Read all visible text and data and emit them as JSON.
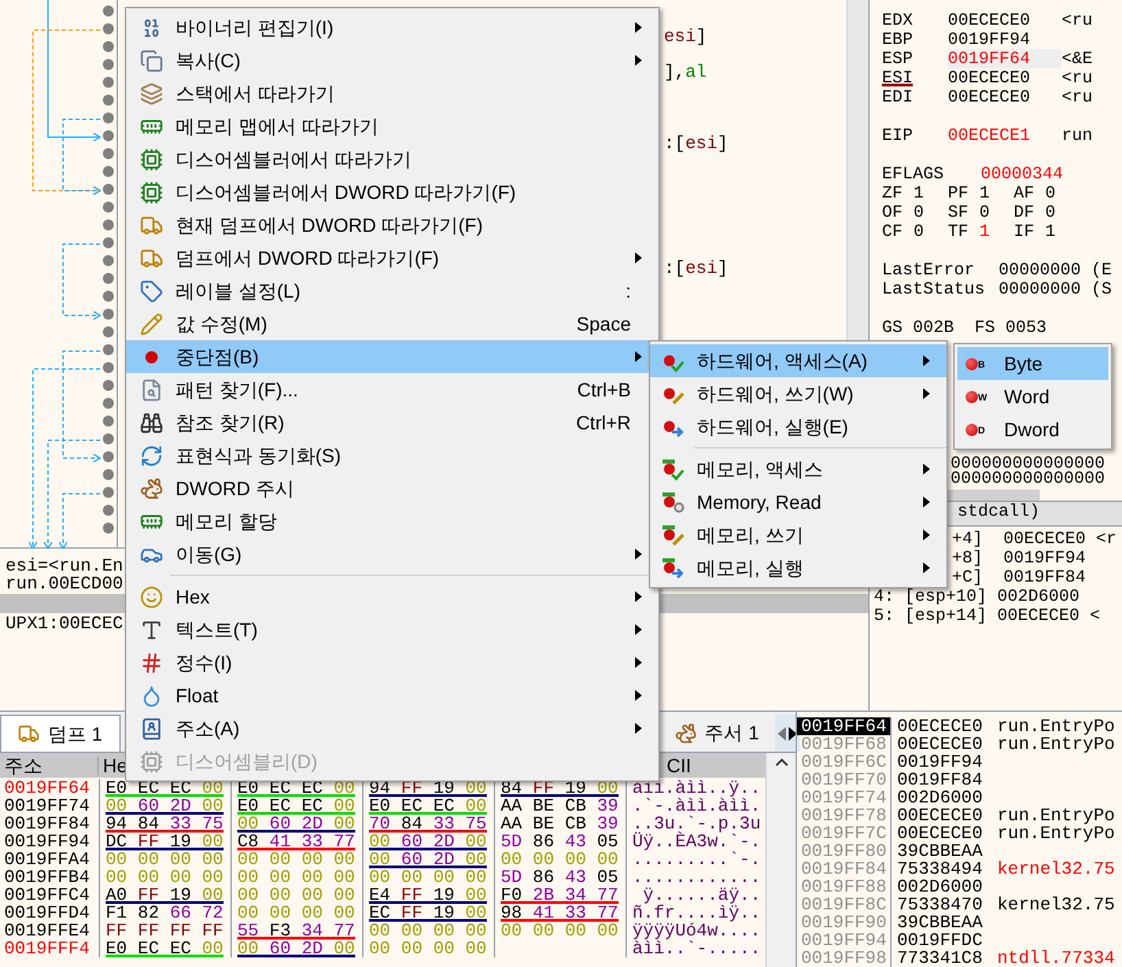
{
  "disassembly": {
    "code_lines": [
      [
        {
          "text": "esi",
          "color": "#800000"
        },
        {
          "text": "]",
          "color": "#000000"
        }
      ],
      [
        {
          "text": "],",
          "color": "#000000"
        },
        {
          "text": "al",
          "color": "#008000"
        }
      ],
      [
        {
          "text": ":[",
          "color": "#000000"
        },
        {
          "text": "esi",
          "color": "#800000"
        },
        {
          "text": "]",
          "color": "#000000"
        }
      ],
      [
        {
          "text": ":[",
          "color": "#000000"
        },
        {
          "text": "esi",
          "color": "#800000"
        },
        {
          "text": "]",
          "color": "#000000"
        }
      ]
    ]
  },
  "info_pane": {
    "lines": [
      "esi=<run.En",
      "run.00ECD00"
    ],
    "section": "UPX1:00ECEC"
  },
  "registers": [
    {
      "name": "EDX",
      "value": "00ECECE0",
      "comment": "<ru",
      "changed": false,
      "underlined": false
    },
    {
      "name": "EBP",
      "value": "0019FF94",
      "changed": false,
      "underlined": false
    },
    {
      "name": "ESP",
      "value": "0019FF64",
      "comment": "<&E",
      "changed": true,
      "underlined": false
    },
    {
      "name": "ESI",
      "value": "00ECECE0",
      "comment": "<ru",
      "changed": false,
      "underlined": true
    },
    {
      "name": "EDI",
      "value": "00ECECE0",
      "comment": "<ru",
      "changed": false,
      "underlined": false
    }
  ],
  "eip": {
    "name": "EIP",
    "value": "00ECECE1",
    "comment": "run",
    "changed": true
  },
  "eflags": {
    "name": "EFLAGS",
    "value": "00000344",
    "changed": true
  },
  "flags": [
    [
      {
        "name": "ZF",
        "value": "1",
        "changed": false
      },
      {
        "name": "PF",
        "value": "1",
        "changed": false
      },
      {
        "name": "AF",
        "value": "0",
        "changed": false
      }
    ],
    [
      {
        "name": "OF",
        "value": "0",
        "changed": false
      },
      {
        "name": "SF",
        "value": "0",
        "changed": false
      },
      {
        "name": "DF",
        "value": "0",
        "changed": false
      }
    ],
    [
      {
        "name": "CF",
        "value": "0",
        "changed": false
      },
      {
        "name": "TF",
        "value": "1",
        "changed": true
      },
      {
        "name": "IF",
        "value": "1",
        "changed": false
      }
    ]
  ],
  "last_error": [
    {
      "name": "LastError",
      "value": "00000000 (E"
    },
    {
      "name": "LastStatus",
      "value": "00000000 (S"
    }
  ],
  "segments": "GS 002B  FS 0053",
  "fpu_lines": [
    "000000000000000",
    "000000000000000"
  ],
  "call_stack": {
    "header": "stdcall)",
    "rows": [
      "+4]  00ECECE0 <r",
      "+8]  0019FF94",
      "+C]  0019FF84",
      "4: [esp+10] 002D6000",
      "5: [esp+14] 00ECECE0 <"
    ]
  },
  "bottom_tabs": [
    {
      "label": "덤프 1",
      "selected": true
    },
    {
      "label": "주서 1",
      "selected": false
    }
  ],
  "dump": {
    "columns": [
      "주소",
      "He",
      "CII"
    ],
    "rows": [
      {
        "address": "0019FF64",
        "highlight": true,
        "groups": [
          {
            "bytes": "E0 EC EC 00",
            "color": "#00e000"
          },
          {
            "bytes": "E0 EC EC 00",
            "color": "#00e000"
          },
          {
            "bytes": "94 FF 19 00",
            "color": "#000080"
          },
          {
            "bytes": "84 FF 19 00",
            "color": "#000080"
          }
        ],
        "ascii": "àìì.àìì..ÿ.."
      },
      {
        "address": "0019FF74",
        "highlight": false,
        "groups": [
          {
            "bytes": "00 60 2D 00",
            "color": "#000080"
          },
          {
            "bytes": "E0 EC EC 00",
            "color": "#00e000"
          },
          {
            "bytes": "E0 EC EC 00",
            "color": "#00e000"
          },
          {
            "bytes": "AA BE CB 39"
          }
        ],
        "ascii": ".`-.àìì.àìì."
      },
      {
        "address": "0019FF84",
        "highlight": false,
        "groups": [
          {
            "bytes": "94 84 33 75",
            "color": "#ff0000"
          },
          {
            "bytes": "00 60 2D 00",
            "color": "#000080"
          },
          {
            "bytes": "70 84 33 75",
            "color": "#ff0000"
          },
          {
            "bytes": "AA BE CB 39"
          }
        ],
        "ascii": "..3u.`-.p.3u"
      },
      {
        "address": "0019FF94",
        "highlight": false,
        "groups": [
          {
            "bytes": "DC FF 19 00",
            "color": "#000080"
          },
          {
            "bytes": "C8 41 33 77",
            "color": "#ff0000"
          },
          {
            "bytes": "00 60 2D 00",
            "color": "#000080"
          },
          {
            "bytes": "5D 86 43 05"
          }
        ],
        "ascii": "Üÿ..ÈA3w.`-."
      },
      {
        "address": "0019FFA4",
        "highlight": false,
        "groups": [
          {
            "bytes": "00 00 00 00"
          },
          {
            "bytes": "00 00 00 00"
          },
          {
            "bytes": "00 60 2D 00",
            "color": "#000080"
          },
          {
            "bytes": "00 00 00 00"
          }
        ],
        "ascii": ".........`-."
      },
      {
        "address": "0019FFB4",
        "highlight": false,
        "groups": [
          {
            "bytes": "00 00 00 00"
          },
          {
            "bytes": "00 00 00 00"
          },
          {
            "bytes": "00 00 00 00"
          },
          {
            "bytes": "5D 86 43 05"
          }
        ],
        "ascii": "............"
      },
      {
        "address": "0019FFC4",
        "highlight": false,
        "groups": [
          {
            "bytes": "A0 FF 19 00",
            "color": "#000080"
          },
          {
            "bytes": "00 00 00 00"
          },
          {
            "bytes": "E4 FF 19 00",
            "color": "#000080"
          },
          {
            "bytes": "F0 2B 34 77",
            "color": "#ff0000"
          }
        ],
        "ascii": " ÿ......äÿ.."
      },
      {
        "address": "0019FFD4",
        "highlight": false,
        "groups": [
          {
            "bytes": "F1 82 66 72"
          },
          {
            "bytes": "00 00 00 00"
          },
          {
            "bytes": "EC FF 19 00",
            "color": "#000080"
          },
          {
            "bytes": "98 41 33 77",
            "color": "#ff0000"
          }
        ],
        "ascii": "ñ.fr....ìÿ.."
      },
      {
        "address": "0019FFE4",
        "highlight": false,
        "groups": [
          {
            "bytes": "FF FF FF FF"
          },
          {
            "bytes": "55 F3 34 77",
            "color": "#ff0000"
          },
          {
            "bytes": "00 00 00 00"
          },
          {
            "bytes": "00 00 00 00"
          }
        ],
        "ascii": "ÿÿÿÿUó4w...."
      },
      {
        "address": "0019FFF4",
        "highlight": true,
        "groups": [
          {
            "bytes": "E0 EC EC 00",
            "color": "#00e000"
          },
          {
            "bytes": "00 60 2D 00",
            "color": "#000080"
          },
          {
            "bytes": "00 00 00 00"
          }
        ],
        "ascii": "àìì..`-....."
      }
    ]
  },
  "stack": [
    {
      "address": "0019FF64",
      "value": "00ECECE0",
      "comment": "run.EntryPo",
      "selected": true,
      "alert": false
    },
    {
      "address": "0019FF68",
      "value": "00ECECE0",
      "comment": "run.EntryPo",
      "selected": false,
      "alert": false
    },
    {
      "address": "0019FF6C",
      "value": "0019FF94",
      "selected": false
    },
    {
      "address": "0019FF70",
      "value": "0019FF84",
      "selected": false
    },
    {
      "address": "0019FF74",
      "value": "002D6000",
      "selected": false
    },
    {
      "address": "0019FF78",
      "value": "00ECECE0",
      "comment": "run.EntryPo",
      "selected": false,
      "alert": false
    },
    {
      "address": "0019FF7C",
      "value": "00ECECE0",
      "comment": "run.EntryPo",
      "selected": false,
      "alert": false
    },
    {
      "address": "0019FF80",
      "value": "39CBBEAA",
      "selected": false
    },
    {
      "address": "0019FF84",
      "value": "75338494",
      "comment": "kernel32.75",
      "selected": false,
      "alert": true
    },
    {
      "address": "0019FF88",
      "value": "002D6000",
      "selected": false
    },
    {
      "address": "0019FF8C",
      "value": "75338470",
      "comment": "kernel32.75",
      "selected": false,
      "alert": false
    },
    {
      "address": "0019FF90",
      "value": "39CBBEAA",
      "selected": false
    },
    {
      "address": "0019FF94",
      "value": "0019FFDC",
      "selected": false
    },
    {
      "address": "0019FF98",
      "value": "773341C8",
      "comment": "ntdll.77334",
      "selected": false,
      "alert": true
    }
  ],
  "context_menu": {
    "items": [
      {
        "kind": "item",
        "label": "바이너리 편집기(I)",
        "submenu": true,
        "selected": false,
        "disabled": false
      },
      {
        "kind": "item",
        "label": "복사(C)",
        "submenu": true,
        "selected": false,
        "disabled": false
      },
      {
        "kind": "item",
        "label": "스택에서 따라가기",
        "submenu": false,
        "selected": false,
        "disabled": false
      },
      {
        "kind": "item",
        "label": "메모리 맵에서 따라가기",
        "submenu": false,
        "selected": false,
        "disabled": false
      },
      {
        "kind": "item",
        "label": "디스어셈블러에서 따라가기",
        "submenu": false,
        "selected": false,
        "disabled": false
      },
      {
        "kind": "item",
        "label": "디스어셈블러에서 DWORD 따라가기(F)",
        "submenu": false,
        "selected": false,
        "disabled": false
      },
      {
        "kind": "item",
        "label": "현재 덤프에서 DWORD 따라가기(F)",
        "submenu": false,
        "selected": false,
        "disabled": false
      },
      {
        "kind": "item",
        "label": "덤프에서 DWORD 따라가기(F)",
        "submenu": true,
        "selected": false,
        "disabled": false
      },
      {
        "kind": "item",
        "label": "레이블 설정(L)",
        "shortcut": ":",
        "submenu": false,
        "selected": false,
        "disabled": false
      },
      {
        "kind": "item",
        "label": "값 수정(M)",
        "shortcut": "Space",
        "submenu": false,
        "selected": false,
        "disabled": false
      },
      {
        "kind": "item",
        "label": "중단점(B)",
        "submenu": true,
        "selected": true,
        "disabled": false
      },
      {
        "kind": "item",
        "label": "패턴 찾기(F)...",
        "shortcut": "Ctrl+B",
        "submenu": false,
        "selected": false,
        "disabled": false
      },
      {
        "kind": "item",
        "label": "참조 찾기(R)",
        "shortcut": "Ctrl+R",
        "submenu": false,
        "selected": false,
        "disabled": false
      },
      {
        "kind": "item",
        "label": "표현식과 동기화(S)",
        "submenu": false,
        "selected": false,
        "disabled": false
      },
      {
        "kind": "item",
        "label": "DWORD 주시",
        "submenu": false,
        "selected": false,
        "disabled": false
      },
      {
        "kind": "item",
        "label": "메모리 할당",
        "submenu": false,
        "selected": false,
        "disabled": false
      },
      {
        "kind": "item",
        "label": "이동(G)",
        "submenu": true,
        "selected": false,
        "disabled": false
      },
      {
        "kind": "separator"
      },
      {
        "kind": "item",
        "label": "Hex",
        "submenu": true,
        "selected": false,
        "disabled": false
      },
      {
        "kind": "item",
        "label": "텍스트(T)",
        "submenu": true,
        "selected": false,
        "disabled": false
      },
      {
        "kind": "item",
        "label": "정수(I)",
        "submenu": true,
        "selected": false,
        "disabled": false
      },
      {
        "kind": "item",
        "label": "Float",
        "submenu": true,
        "selected": false,
        "disabled": false
      },
      {
        "kind": "item",
        "label": "주소(A)",
        "submenu": true,
        "selected": false,
        "disabled": false
      },
      {
        "kind": "item",
        "label": "디스어셈블리(D)",
        "submenu": false,
        "selected": false,
        "disabled": true
      }
    ]
  },
  "breakpoint_menu": {
    "items": [
      {
        "kind": "item",
        "label": "하드웨어, 액세스(A)",
        "submenu": true,
        "selected": true
      },
      {
        "kind": "item",
        "label": "하드웨어, 쓰기(W)",
        "submenu": true,
        "selected": false
      },
      {
        "kind": "item",
        "label": "하드웨어, 실행(E)",
        "submenu": false,
        "selected": false
      },
      {
        "kind": "separator"
      },
      {
        "kind": "item",
        "label": "메모리, 액세스",
        "submenu": true,
        "selected": false
      },
      {
        "kind": "item",
        "label": "Memory, Read",
        "submenu": true,
        "selected": false
      },
      {
        "kind": "item",
        "label": "메모리, 쓰기",
        "submenu": true,
        "selected": false
      },
      {
        "kind": "item",
        "label": "메모리, 실행",
        "submenu": true,
        "selected": false
      }
    ]
  },
  "size_menu": {
    "items": [
      {
        "label": "Byte",
        "icon_letter": "B",
        "selected": true
      },
      {
        "label": "Word",
        "icon_letter": "W",
        "selected": false
      },
      {
        "label": "Dword",
        "icon_letter": "D",
        "selected": false
      }
    ]
  }
}
